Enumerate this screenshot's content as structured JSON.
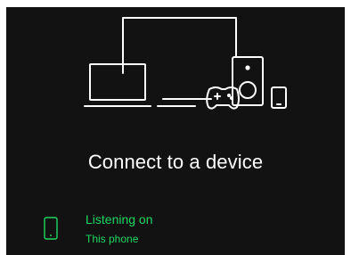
{
  "header": {
    "title": "Connect to a device",
    "illustration_icon": "devices-illustration-icon"
  },
  "current_device": {
    "label": "Listening on",
    "name": "This phone",
    "icon": "phone-icon"
  },
  "colors": {
    "background": "#121212",
    "text": "#ffffff",
    "accent": "#1ed760"
  }
}
